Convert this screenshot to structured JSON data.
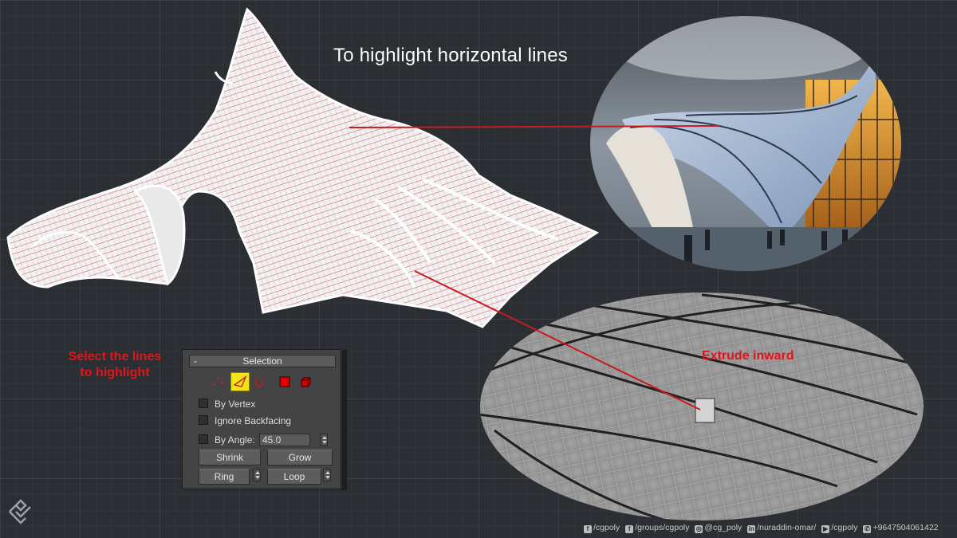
{
  "title": "To highlight horizontal lines",
  "notes": {
    "select_line1": "Select the lines",
    "select_line2": "to highlight",
    "extrude": "Extrude inward"
  },
  "selection_panel": {
    "header": "Selection",
    "collapse_symbol": "-",
    "tools": [
      "vertex-icon",
      "edge-icon",
      "border-icon",
      "polygon-icon",
      "element-icon"
    ],
    "active_tool": "edge-icon",
    "by_vertex_label": "By Vertex",
    "by_vertex_checked": false,
    "ignore_backfacing_label": "Ignore Backfacing",
    "ignore_backfacing_checked": false,
    "by_angle_label": "By Angle:",
    "by_angle_checked": false,
    "angle_value": "45.0",
    "shrink_label": "Shrink",
    "grow_label": "Grow",
    "ring_label": "Ring",
    "loop_label": "Loop"
  },
  "footer": {
    "facebook": "/cgpoly",
    "facebook_group": "/groups/cgpoly",
    "instagram": "@cg_poly",
    "linkedin": "/nuraddin-omar/",
    "youtube": "/cgpoly",
    "phone": "+9647504061422"
  },
  "colors": {
    "background": "#2b2f34",
    "accent_red": "#e0141b",
    "active_tool": "#f3e413",
    "panel": "#444444"
  }
}
